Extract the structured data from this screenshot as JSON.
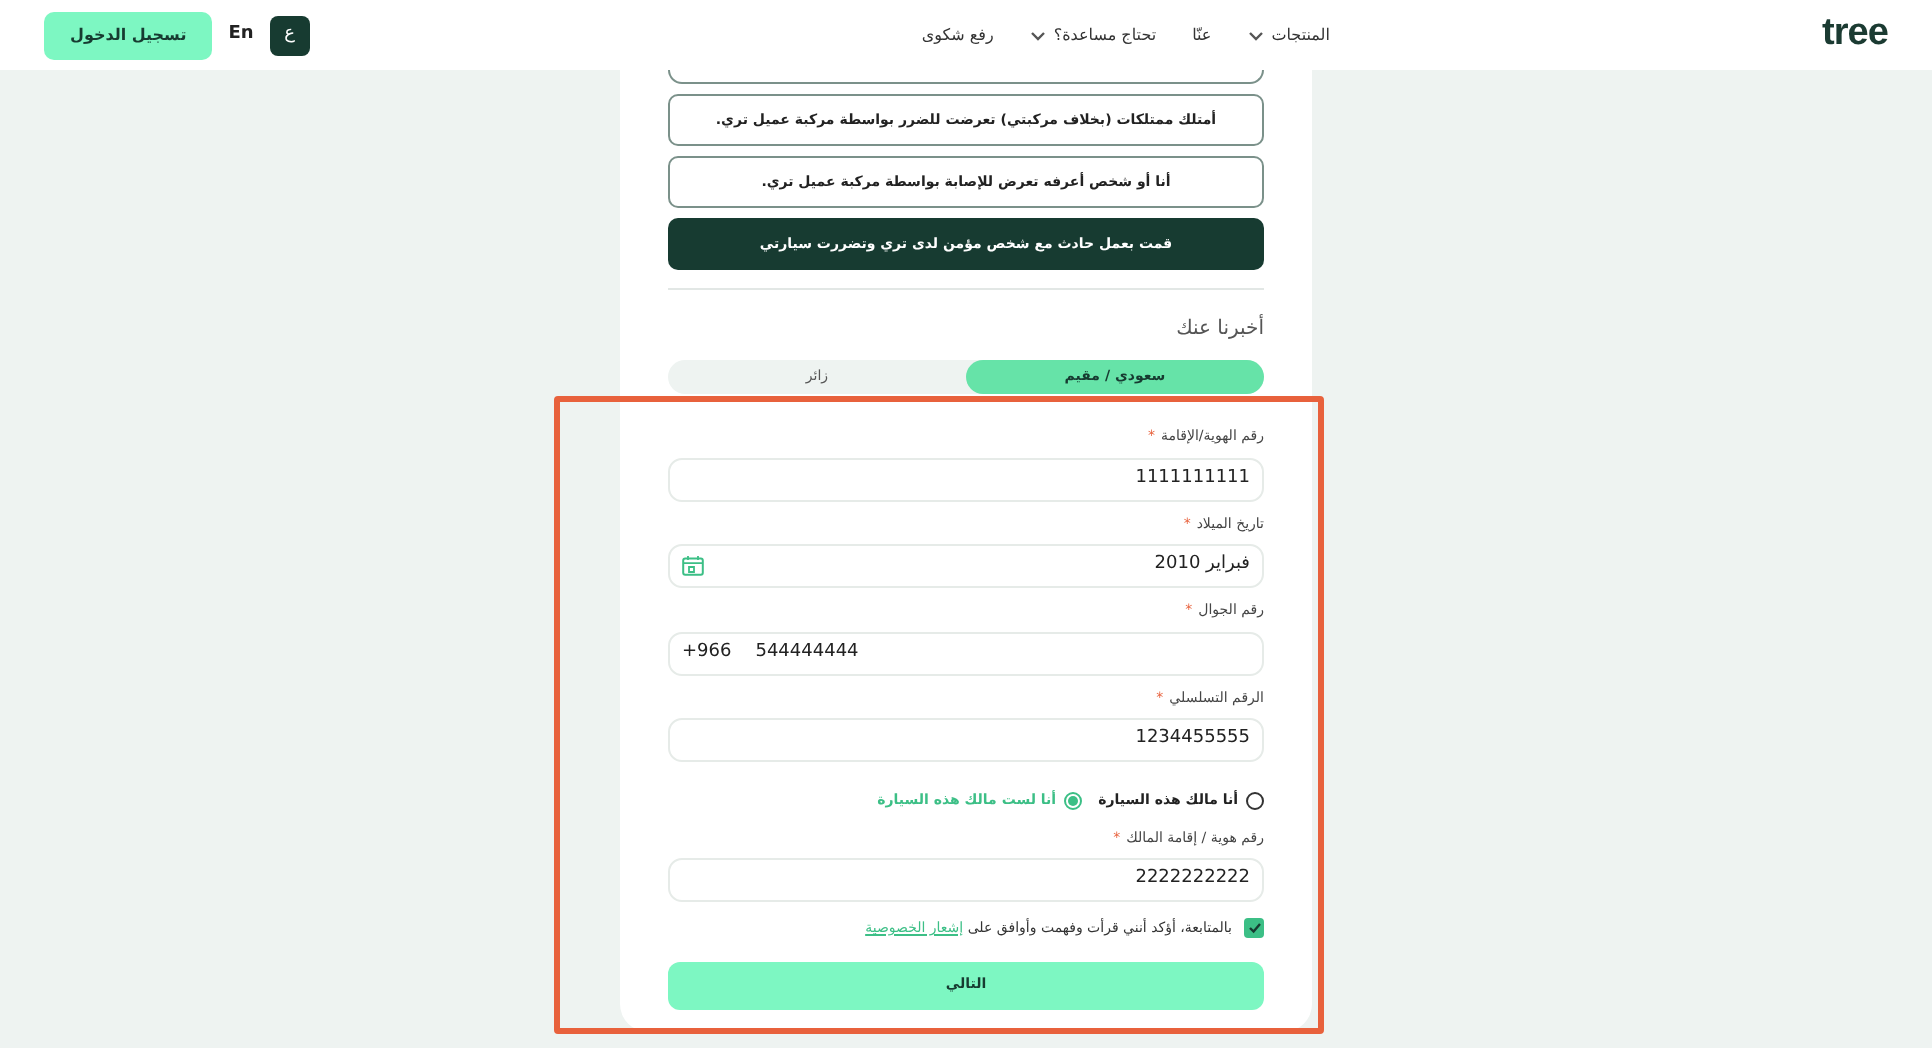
{
  "header": {
    "logo": "tree",
    "nav": [
      {
        "label": "المنتجات",
        "dropdown": true
      },
      {
        "label": "عنّا",
        "dropdown": false
      },
      {
        "label": "تحتاج مساعدة؟",
        "dropdown": true
      },
      {
        "label": "رفع شكوى",
        "dropdown": false
      }
    ],
    "languages": [
      {
        "label": "ع",
        "selected": true
      },
      {
        "label": "En",
        "selected": false
      }
    ],
    "login_button": "تسجيل الدخول"
  },
  "options": [
    {
      "kind": "partial",
      "selected": false
    },
    {
      "kind": "full",
      "label": "أمتلك ممتلكات (بخلاف مركبتي) تعرضت للضرر بواسطة مركبة عميل تري.",
      "selected": false
    },
    {
      "kind": "full",
      "label": "أنا أو شخص أعرفه تعرض للإصابة بواسطة مركبة عميل تري.",
      "selected": false
    },
    {
      "kind": "full",
      "label": "قمت بعمل حادث مع شخص مؤمن لدى تري وتضررت سيارتي",
      "selected": true
    }
  ],
  "section_title": "أخبرنا عنك",
  "tabs": [
    {
      "label": "سعودي / مقيم",
      "selected": true
    },
    {
      "label": "زائر",
      "selected": false
    }
  ],
  "fields": [
    {
      "kind": "text",
      "label": "رقم الهوية/الإقامة",
      "required_mark": "*",
      "value": "1111111111"
    },
    {
      "kind": "date",
      "label": "تاريخ الميلاد",
      "required_mark": "*",
      "value": "فبراير 2010"
    },
    {
      "kind": "phone",
      "label": "رقم الجوال",
      "required_mark": "*",
      "prefix": "+966",
      "value": "544444444"
    },
    {
      "kind": "text",
      "label": "الرقم التسلسلي",
      "required_mark": "*",
      "value": "1234455555"
    }
  ],
  "ownership": [
    {
      "label": "أنا مالك هذه السيارة",
      "selected": false
    },
    {
      "label": "أنا لست مالك هذه السيارة",
      "selected": true
    }
  ],
  "owner_field": {
    "label": "رقم هوية / إقامة المالك",
    "required_mark": "*",
    "value": "2222222222"
  },
  "consent": {
    "checked": true,
    "text": "بالمتابعة، أؤكد أنني قرأت وفهمت وأوافق على",
    "link": "إشعار الخصوصية"
  },
  "next_button": "التالي",
  "highlight": {
    "color": "#e8613c"
  }
}
